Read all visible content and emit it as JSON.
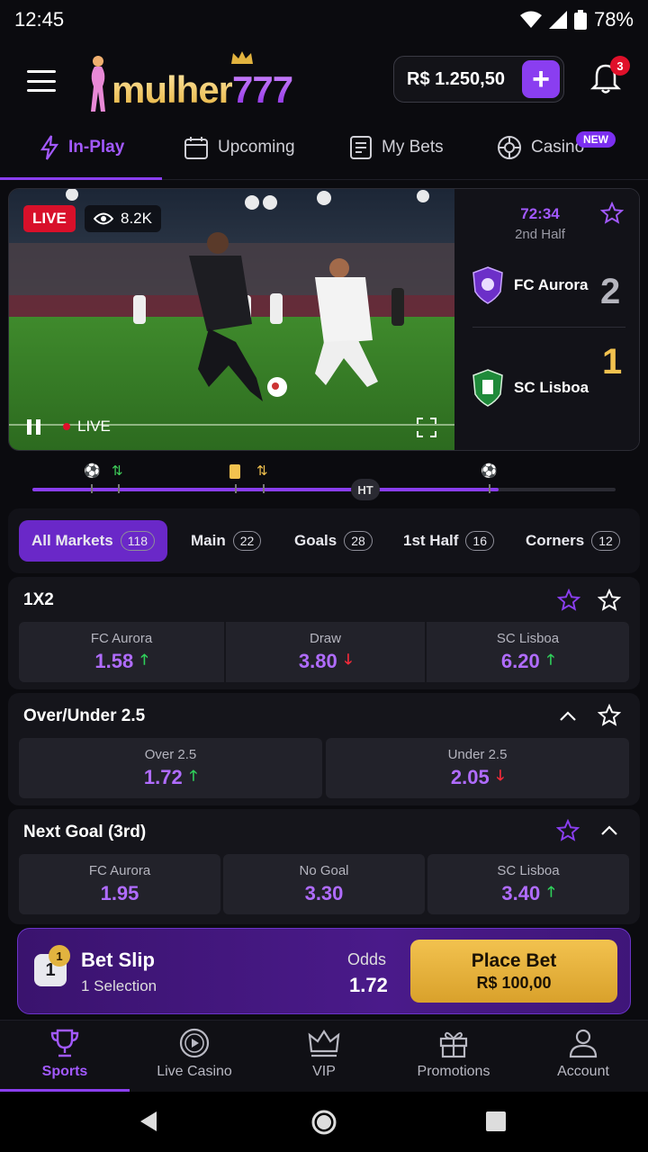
{
  "status_bar": {
    "time": "12:45",
    "battery": "78%"
  },
  "header": {
    "logo_text_a": "mulher",
    "logo_text_b": "777",
    "balance": "R$ 1.250,50",
    "deposit_label": "+",
    "notifications_count": "3"
  },
  "tabs": [
    {
      "label": "In-Play",
      "icon": "lightning-icon",
      "active": true
    },
    {
      "label": "Upcoming",
      "icon": "calendar-icon"
    },
    {
      "label": "My Bets",
      "icon": "betslip-icon"
    },
    {
      "label": "Casino",
      "icon": "roulette-icon",
      "badge": "NEW"
    }
  ],
  "live_match": {
    "live_badge": "LIVE",
    "viewers": "8.2K",
    "live_inline": "LIVE",
    "clock": "72:34",
    "period": "2nd Half",
    "home": {
      "name": "FC Aurora",
      "score": "2"
    },
    "away": {
      "name": "SC Lisboa",
      "score": "1"
    }
  },
  "timeline": {
    "ht_label": "HT",
    "progress_fraction": 0.8
  },
  "market_filters": [
    {
      "label": "All Markets",
      "count": "118",
      "active": true
    },
    {
      "label": "Main",
      "count": "22"
    },
    {
      "label": "Goals",
      "count": "28"
    },
    {
      "label": "1st Half",
      "count": "16"
    },
    {
      "label": "Corners",
      "count": "12"
    }
  ],
  "markets": [
    {
      "title": "1X2",
      "odds": [
        {
          "label": "FC Aurora",
          "value": "1.58",
          "trend": "up"
        },
        {
          "label": "Draw",
          "value": "3.80",
          "trend": "down"
        },
        {
          "label": "SC Lisboa",
          "value": "6.20",
          "trend": "up"
        }
      ]
    },
    {
      "title": "Over/Under 2.5",
      "odds": [
        {
          "label": "Over 2.5",
          "value": "1.72",
          "trend": "up"
        },
        {
          "label": "Under 2.5",
          "value": "2.05",
          "trend": "down"
        }
      ]
    },
    {
      "title": "Next Goal (3rd)",
      "odds": [
        {
          "label": "FC Aurora",
          "value": "1.95",
          "trend": ""
        },
        {
          "label": "No Goal",
          "value": "3.30",
          "trend": ""
        },
        {
          "label": "SC Lisboa",
          "value": "3.40",
          "trend": "up"
        }
      ]
    }
  ],
  "bet_slip": {
    "count": "1",
    "badge": "1",
    "title": "Bet Slip",
    "subtitle": "1 Selection",
    "odds_label": "Odds",
    "odds": "1.72",
    "place_label": "Place Bet",
    "stake": "R$ 100,00"
  },
  "bottom_nav": [
    {
      "label": "Sports",
      "icon": "trophy-icon",
      "active": true
    },
    {
      "label": "Live Casino",
      "icon": "play-circle-icon"
    },
    {
      "label": "VIP",
      "icon": "crown-icon"
    },
    {
      "label": "Promotions",
      "icon": "gift-icon"
    },
    {
      "label": "Account",
      "icon": "user-icon"
    }
  ],
  "colors": {
    "accent": "#8a3ef0",
    "gold": "#e2b33f",
    "up": "#2fcf5a",
    "down": "#ff2a3a"
  }
}
